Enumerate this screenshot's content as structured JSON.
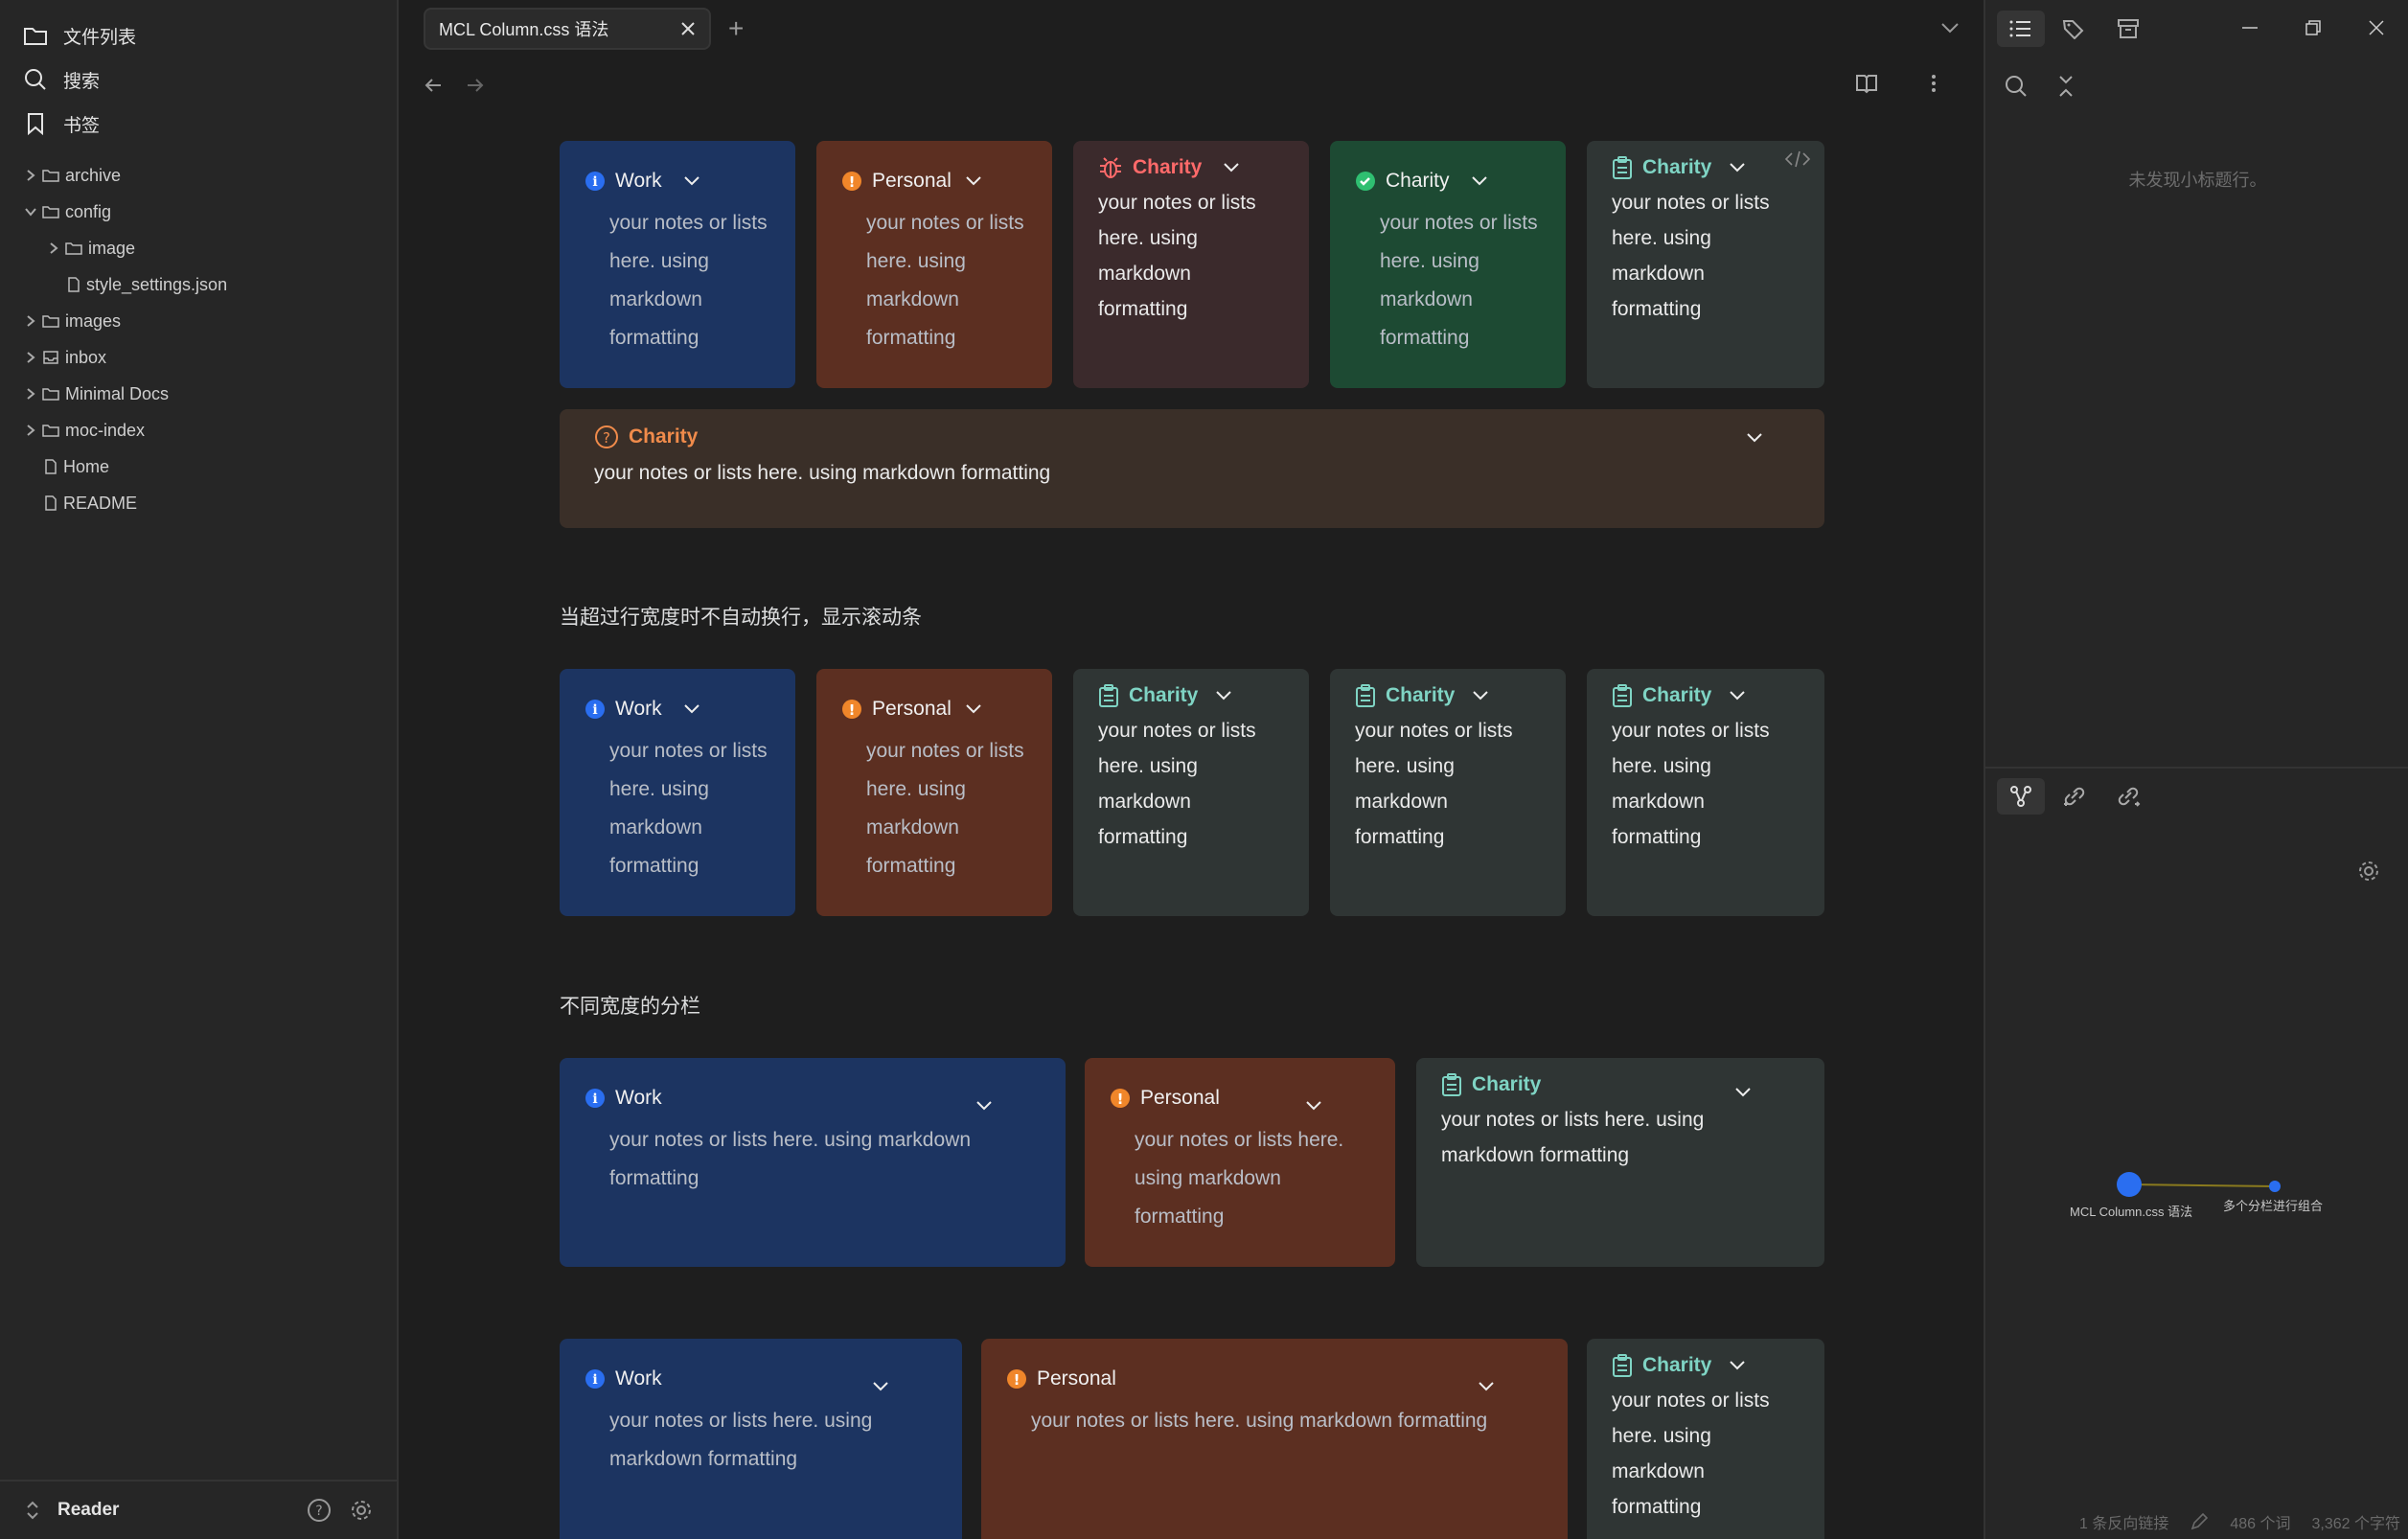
{
  "sidebar": {
    "files_label": "文件列表",
    "search_label": "搜索",
    "bookmarks_label": "书签",
    "tree": [
      {
        "name": "archive",
        "type": "folder",
        "open": false,
        "level": 0
      },
      {
        "name": "config",
        "type": "folder",
        "open": true,
        "level": 0
      },
      {
        "name": "image",
        "type": "folder",
        "open": false,
        "level": 1
      },
      {
        "name": "style_settings.json",
        "type": "file",
        "level": 1
      },
      {
        "name": "images",
        "type": "folder",
        "open": false,
        "level": 0
      },
      {
        "name": "inbox",
        "type": "folder-special",
        "open": false,
        "level": 0
      },
      {
        "name": "Minimal Docs",
        "type": "folder",
        "open": false,
        "level": 0
      },
      {
        "name": "moc-index",
        "type": "folder",
        "open": false,
        "level": 0
      },
      {
        "name": "Home",
        "type": "file",
        "level": 0
      },
      {
        "name": "README",
        "type": "file",
        "level": 0
      }
    ],
    "vault_name": "Reader"
  },
  "tab": {
    "title": "MCL Column.css 语法"
  },
  "content": {
    "work": "Work",
    "personal": "Personal",
    "charity": "Charity",
    "body": "your notes or lists here. using markdown formatting",
    "heading1": "当超过行宽度时不自动换行，显示滚动条",
    "heading2": "不同宽度的分栏"
  },
  "right": {
    "outline_empty": "未发现小标题行。",
    "graph_node_a": "MCL  Column.css 语法",
    "graph_node_b": "多个分栏进行组合",
    "status_backlinks": "1 条反向链接",
    "status_words": "486 个词",
    "status_chars": "3,362 个字符"
  },
  "colors": {
    "blue": "#1c3461",
    "orange": "#5c2f21",
    "maroon": "#3b2a2c",
    "green": "#1d4a33",
    "gray": "#2f3534",
    "brown": "#3a2f28",
    "accent": "#2a6ef0"
  }
}
